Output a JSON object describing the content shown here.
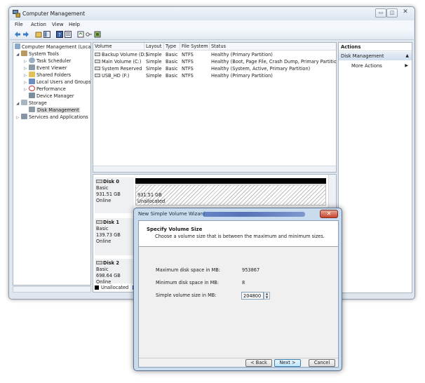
{
  "window": {
    "title": "Computer Management",
    "min_glyph": "▭",
    "max_glyph": "◫",
    "close_glyph": "✕"
  },
  "menu": [
    "File",
    "Action",
    "View",
    "Help"
  ],
  "tree": {
    "items": [
      {
        "label": "Computer Management (Local",
        "exp": "",
        "level": 0
      },
      {
        "label": "System Tools",
        "exp": "◢",
        "level": 1
      },
      {
        "label": "Task Scheduler",
        "exp": "▷",
        "level": 2
      },
      {
        "label": "Event Viewer",
        "exp": "▷",
        "level": 2
      },
      {
        "label": "Shared Folders",
        "exp": "▷",
        "level": 2
      },
      {
        "label": "Local Users and Groups",
        "exp": "▷",
        "level": 2
      },
      {
        "label": "Performance",
        "exp": "▷",
        "level": 2
      },
      {
        "label": "Device Manager",
        "exp": "",
        "level": 2
      },
      {
        "label": "Storage",
        "exp": "◢",
        "level": 1
      },
      {
        "label": "Disk Management",
        "exp": "",
        "level": 2,
        "selected": true
      },
      {
        "label": "Services and Applications",
        "exp": "▷",
        "level": 1
      }
    ]
  },
  "volumes": {
    "headers": [
      "Volume",
      "Layout",
      "Type",
      "File System",
      "Status"
    ],
    "rows": [
      [
        "Backup Volume (D:)",
        "Simple",
        "Basic",
        "NTFS",
        "Healthy (Primary Partition)"
      ],
      [
        "Main Volume (C:)",
        "Simple",
        "Basic",
        "NTFS",
        "Healthy (Boot, Page File, Crash Dump, Primary Partition)"
      ],
      [
        "System Reserved",
        "Simple",
        "Basic",
        "NTFS",
        "Healthy (System, Active, Primary Partition)"
      ],
      [
        "USB_HD (F:)",
        "Simple",
        "Basic",
        "NTFS",
        "Healthy (Primary Partition)"
      ]
    ]
  },
  "disks": [
    {
      "name": "Disk 0",
      "type": "Basic",
      "size": "931.51 GB",
      "state": "Online"
    },
    {
      "name": "Disk 1",
      "type": "Basic",
      "size": "139.73 GB",
      "state": "Online"
    },
    {
      "name": "Disk 2",
      "type": "Basic",
      "size": "698.64 GB",
      "state": "Online"
    }
  ],
  "disk0_partition": {
    "size": "931.51 GB",
    "state": "Unallocated"
  },
  "legend": {
    "unallocated": "Unallocated"
  },
  "actions": {
    "title": "Actions",
    "section": "Disk Management",
    "more": "More Actions"
  },
  "wizard": {
    "title": "New Simple Volume Wizard",
    "heading": "Specify Volume Size",
    "subheading": "Choose a volume size that is between the maximum and minimum sizes.",
    "max_label": "Maximum disk space in MB:",
    "max_value": "953867",
    "min_label": "Minimum disk space in MB:",
    "min_value": "8",
    "size_label": "Simple volume size in MB:",
    "size_value": "204800",
    "back": "< Back",
    "next": "Next >",
    "cancel": "Cancel"
  },
  "colors": {
    "accent": "#3c7fb1",
    "unallocated": "#000000",
    "primary_partition": "#1f3fa0"
  }
}
